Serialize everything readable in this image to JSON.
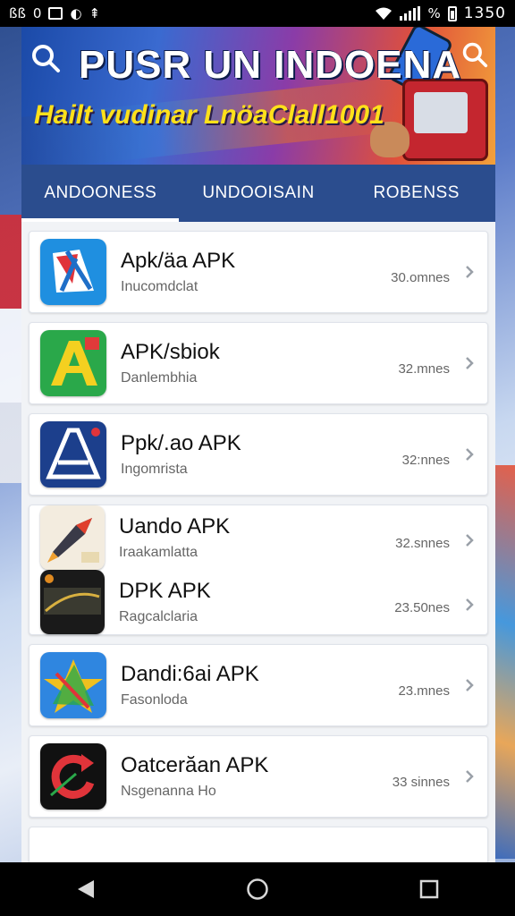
{
  "status_bar": {
    "left_text": "ßß",
    "left_text_2": "0",
    "time": "1350",
    "percent": "%"
  },
  "banner": {
    "title": "PUSR UN INDOENA",
    "subtitle": "Hailt vudinar LnöaClall1001"
  },
  "tabs": [
    {
      "label": "ANDOONESS"
    },
    {
      "label": "UNDOOISAIN"
    },
    {
      "label": "ROBENSS"
    }
  ],
  "apps": [
    {
      "name": "Apk/äa APK",
      "sub": "Inucomdclat",
      "size": "30.omnes",
      "icon": "blue-tile-icon"
    },
    {
      "name": "APK/sbiok",
      "sub": "Danlembhia",
      "size": "32.mnes",
      "icon": "green-a-icon"
    },
    {
      "name": "Ppk/.ao APK",
      "sub": "Ingomrista",
      "size": "32:nnes",
      "icon": "navy-a-icon"
    },
    {
      "name": "Uando APK",
      "sub": "Iraakamlatta",
      "size": "32.snnes",
      "icon": "rocket-icon"
    },
    {
      "name": "DPK APK",
      "sub": "Ragcalclaria",
      "size": "23.50nes",
      "icon": "dark-grunge-icon"
    },
    {
      "name": "Dandi:6ai APK",
      "sub": "Fasonloda",
      "size": "23.mnes",
      "icon": "star-tile-icon"
    },
    {
      "name": "Oatcerăan APK",
      "sub": "Nsgenanna Ho",
      "size": "33 sinnes",
      "icon": "red-refresh-icon"
    }
  ],
  "colors": {
    "tab_bar": "#2b4d8e",
    "card": "#ffffff",
    "banner_title": "#ffffff",
    "banner_subtitle": "#ffe11a"
  }
}
